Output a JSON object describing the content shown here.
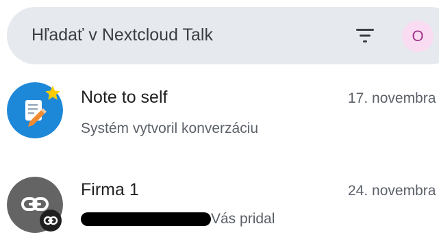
{
  "search": {
    "placeholder": "Hľadať v Nextcloud Talk",
    "avatar_initial": "O"
  },
  "conversations": [
    {
      "name": "Note to self",
      "subtitle": "Systém vytvoril konverzáciu",
      "date": "17. novembra"
    },
    {
      "name": "Firma 1",
      "subtitle": "Vás pridal",
      "date": "24. novembra"
    }
  ],
  "colors": {
    "accent": "#0082c9",
    "favorite": "#ffcc00",
    "group_avatar": "#646464"
  }
}
